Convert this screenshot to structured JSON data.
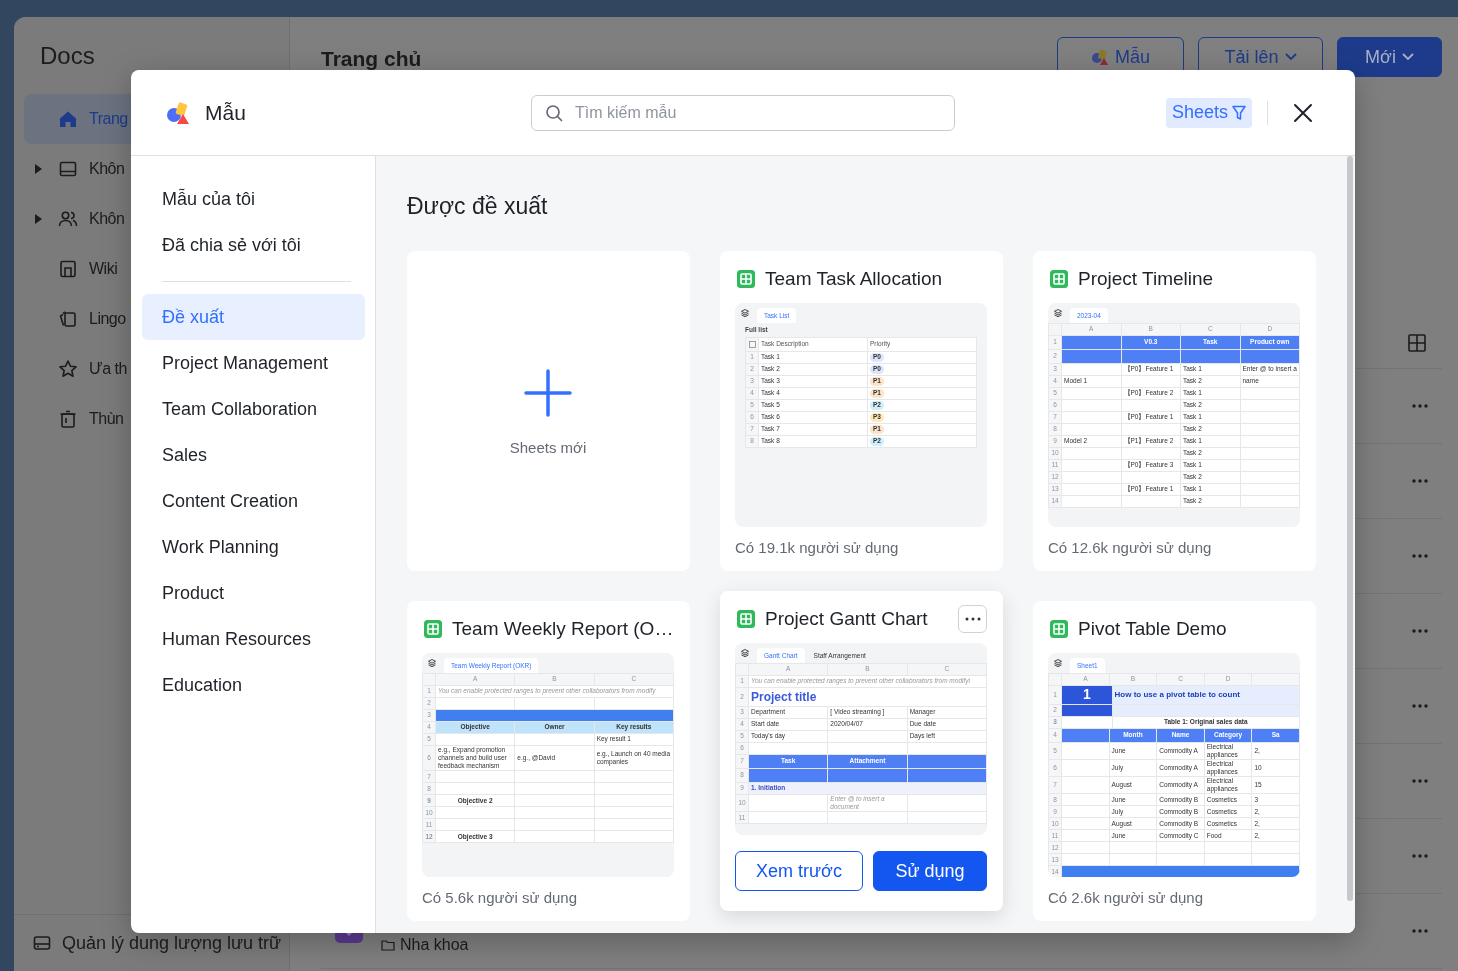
{
  "app": {
    "title": "Docs",
    "nav": [
      {
        "label": "Trang",
        "kind": "home",
        "expandable": false,
        "selected": true
      },
      {
        "label": "Khôn",
        "kind": "tray",
        "expandable": true,
        "selected": false
      },
      {
        "label": "Khôn",
        "kind": "people",
        "expandable": true,
        "selected": false
      },
      {
        "label": "Wiki",
        "kind": "wiki",
        "expandable": false,
        "selected": false
      },
      {
        "label": "Lingo",
        "kind": "cards",
        "expandable": false,
        "selected": false
      },
      {
        "label": "Ưa th",
        "kind": "star",
        "expandable": false,
        "selected": false
      },
      {
        "label": "Thùn",
        "kind": "trash",
        "expandable": false,
        "selected": false
      }
    ],
    "storage": "Quản lý dung lượng lưu trữ",
    "page_title": "Trang chủ",
    "actions": [
      {
        "label": "Mẫu",
        "kind": "template"
      },
      {
        "label": "Tải lên",
        "kind": "dropdown"
      },
      {
        "label": "Mới",
        "kind": "primary"
      }
    ],
    "last_row_folder": "Nha khoa"
  },
  "modal": {
    "title": "Mẫu",
    "search": {
      "placeholder": "Tìm kiếm mẫu"
    },
    "filter": "Sheets",
    "personal": [
      {
        "label": "Mẫu của tôi",
        "selected": false
      },
      {
        "label": "Đã chia sẻ với tôi",
        "selected": false
      }
    ],
    "categories": [
      {
        "label": "Đề xuất",
        "selected": true
      },
      {
        "label": "Project Management",
        "selected": false
      },
      {
        "label": "Team Collaboration",
        "selected": false
      },
      {
        "label": "Sales",
        "selected": false
      },
      {
        "label": "Content Creation",
        "selected": false
      },
      {
        "label": "Work Planning",
        "selected": false
      },
      {
        "label": "Product",
        "selected": false
      },
      {
        "label": "Human Resources",
        "selected": false
      },
      {
        "label": "Education",
        "selected": false
      }
    ],
    "section_title": "Được đề xuất",
    "cards": [
      {
        "kind": "new",
        "label": "Sheets mới"
      },
      {
        "kind": "template",
        "title": "Team Task Allocation",
        "hovered": false,
        "usage": "Có 19.1k người sử dụng",
        "preview": {
          "tabs": [
            {
              "label": "Task List",
              "selected": true
            }
          ],
          "caption": "Full list",
          "rows": [
            {
              "kind": "colhead",
              "cells": [
                "Task Description",
                "Priority"
              ]
            },
            {
              "num": "1",
              "cells": [
                "Task 1",
                {
                  "text": "P0",
                  "color": "#dde4fb"
                }
              ]
            },
            {
              "num": "2",
              "cells": [
                "Task 2",
                {
                  "text": "P0",
                  "color": "#dde4fb"
                }
              ]
            },
            {
              "num": "3",
              "cells": [
                "Task 3",
                {
                  "text": "P1",
                  "color": "#fde2c8"
                }
              ]
            },
            {
              "num": "4",
              "cells": [
                "Task 4",
                {
                  "text": "P1",
                  "color": "#fde2c8"
                }
              ]
            },
            {
              "num": "5",
              "cells": [
                "Task 5",
                {
                  "text": "P2",
                  "color": "#cdeefb"
                }
              ]
            },
            {
              "num": "6",
              "cells": [
                "Task 6",
                {
                  "text": "P3",
                  "color": "#fde9b8"
                }
              ]
            },
            {
              "num": "7",
              "cells": [
                "Task 7",
                {
                  "text": "P1",
                  "color": "#fde2c8"
                }
              ]
            },
            {
              "num": "8",
              "cells": [
                "Task 8",
                {
                  "text": "P2",
                  "color": "#cdeefb"
                }
              ]
            }
          ]
        }
      },
      {
        "kind": "template",
        "title": "Project Timeline",
        "hovered": false,
        "usage": "Có 12.6k người sử dụng",
        "preview": {
          "tabs": [
            {
              "label": "2023-04",
              "selected": true
            }
          ],
          "columns": [
            "A",
            "B",
            "C",
            "D"
          ],
          "rows": [
            {
              "num": "1",
              "kind": "head",
              "cells": [
                null,
                "V0.3",
                "Task",
                "Product own"
              ]
            },
            {
              "num": "2",
              "kind": "head",
              "cells": [
                null,
                null,
                null,
                null
              ]
            },
            {
              "num": "3",
              "cells": [
                null,
                "【P0】Feature 1",
                "Task 1",
                "Enter @ to insert a"
              ]
            },
            {
              "num": "4",
              "cells": [
                "Model 1",
                null,
                "Task 2",
                "name"
              ]
            },
            {
              "num": "5",
              "cells": [
                null,
                "【P0】Feature 2",
                "Task 1",
                null
              ]
            },
            {
              "num": "6",
              "cells": [
                null,
                null,
                "Task 2",
                null
              ]
            },
            {
              "num": "7",
              "cells": [
                null,
                "【P0】Feature 1",
                "Task 1",
                null
              ]
            },
            {
              "num": "8",
              "cells": [
                null,
                null,
                "Task 2",
                null
              ]
            },
            {
              "num": "9",
              "cells": [
                "Model 2",
                "【P1】Feature 2",
                "Task 1",
                null
              ]
            },
            {
              "num": "10",
              "cells": [
                null,
                null,
                "Task 2",
                null
              ]
            },
            {
              "num": "11",
              "cells": [
                null,
                "【P0】Feature 3",
                "Task 1",
                null
              ]
            },
            {
              "num": "12",
              "cells": [
                null,
                null,
                "Task 2",
                null
              ]
            },
            {
              "num": "13",
              "cells": [
                null,
                "【P0】Feature 1",
                "Task 1",
                null
              ]
            },
            {
              "num": "14",
              "cells": [
                null,
                null,
                "Task 2",
                null
              ]
            }
          ]
        }
      },
      {
        "kind": "template",
        "title": "Team Weekly Report (O…",
        "hovered": false,
        "usage": "Có 5.6k người sử dụng",
        "preview": {
          "tabs": [
            {
              "label": "Team Weekly Report (OKR)",
              "selected": true
            }
          ],
          "columns": [
            "A",
            "B",
            "C"
          ],
          "rows": [
            {
              "num": "1",
              "kind": "note",
              "cells": [
                "You can enable protected ranges to prevent other collaborators from modify"
              ]
            },
            {
              "num": "2",
              "cells": [
                null,
                null,
                null
              ]
            },
            {
              "num": "3",
              "kind": "band",
              "cells": [
                null
              ]
            },
            {
              "num": "4",
              "kind": "subhead",
              "cells": [
                "Objective",
                "Owner",
                "Key results"
              ]
            },
            {
              "num": "5",
              "cells": [
                null,
                null,
                "Key result 1"
              ]
            },
            {
              "num": "6",
              "cells": [
                "e.g., Expand promotion channels and build user feedback mechanism",
                "e.g., @David",
                "e.g., Launch on 40 media companies"
              ]
            },
            {
              "num": "7",
              "cells": [
                null,
                null,
                null
              ]
            },
            {
              "num": "8",
              "cells": [
                null,
                null,
                null
              ]
            },
            {
              "num": "9",
              "kind": "bold",
              "cells": [
                "Objective 2",
                null,
                null
              ]
            },
            {
              "num": "10",
              "cells": [
                null,
                null,
                null
              ]
            },
            {
              "num": "11",
              "cells": [
                null,
                null,
                null
              ]
            },
            {
              "num": "12",
              "kind": "bold",
              "cells": [
                "Objective 3",
                null,
                null
              ]
            }
          ]
        }
      },
      {
        "kind": "template",
        "title": "Project Gantt Chart",
        "hovered": true,
        "actions": [
          "Xem trước",
          "Sử dụng"
        ],
        "preview": {
          "tabs": [
            {
              "label": "Gantt Chart",
              "selected": true
            },
            {
              "label": "Staff Arrangement",
              "selected": false
            }
          ],
          "columns": [
            "A",
            "B",
            "C"
          ],
          "rows": [
            {
              "num": "1",
              "kind": "note",
              "cells": [
                "You can enable protected ranges to prevent other collaborators from modifyi"
              ]
            },
            {
              "num": "2",
              "kind": "title",
              "cells": [
                "Project title"
              ]
            },
            {
              "num": "3",
              "cells": [
                "Department",
                "[ Video streaming ]",
                "Manager"
              ]
            },
            {
              "num": "4",
              "cells": [
                "Start date",
                "2020/04/07",
                "Due date"
              ]
            },
            {
              "num": "5",
              "cells": [
                "Today's day",
                null,
                "Days left"
              ]
            },
            {
              "num": "6",
              "cells": [
                null,
                null,
                null
              ]
            },
            {
              "num": "7",
              "kind": "head",
              "cells": [
                "Task",
                "Attachment",
                null
              ]
            },
            {
              "num": "8",
              "kind": "head",
              "cells": [
                null,
                null,
                null
              ]
            },
            {
              "num": "9",
              "kind": "section",
              "cells": [
                "1. Initiation"
              ]
            },
            {
              "num": "10",
              "kind": "note",
              "cells": [
                null,
                "Enter @ to insert a document",
                null
              ]
            },
            {
              "num": "11",
              "cells": [
                null,
                null,
                null
              ]
            }
          ]
        }
      },
      {
        "kind": "template",
        "title": "Pivot Table Demo",
        "hovered": false,
        "usage": "Có 2.6k người sử dụng",
        "preview": {
          "tabs": [
            {
              "label": "Sheet1",
              "selected": true
            }
          ],
          "columns": [
            "A",
            "B",
            "C",
            "D"
          ],
          "rows": [
            {
              "num": "1",
              "kind": "bignum",
              "cells": [
                "1",
                "How to use a pivot table to count"
              ]
            },
            {
              "num": "2",
              "kind": "bignum",
              "cells": [
                null,
                null
              ]
            },
            {
              "num": "3",
              "kind": "bold",
              "cells": [
                null,
                "Table 1: Original sales data"
              ]
            },
            {
              "num": "4",
              "kind": "head",
              "cells": [
                null,
                "Month",
                "Name",
                "Category",
                "Sa"
              ]
            },
            {
              "num": "5",
              "cells": [
                null,
                "June",
                "Commodity A",
                "Electrical appliances",
                "2,"
              ]
            },
            {
              "num": "6",
              "cells": [
                null,
                "July",
                "Commodity A",
                "Electrical appliances",
                "10"
              ]
            },
            {
              "num": "7",
              "cells": [
                null,
                "August",
                "Commodity A",
                "Electrical appliances",
                "15"
              ]
            },
            {
              "num": "8",
              "cells": [
                null,
                "June",
                "Commodity B",
                "Cosmetics",
                "3"
              ]
            },
            {
              "num": "9",
              "cells": [
                null,
                "July",
                "Commodity B",
                "Cosmetics",
                "2,"
              ]
            },
            {
              "num": "10",
              "cells": [
                null,
                "August",
                "Commodity B",
                "Cosmetics",
                "2,"
              ]
            },
            {
              "num": "11",
              "cells": [
                null,
                "June",
                "Commodity C",
                "Food",
                "2,"
              ]
            },
            {
              "num": "12",
              "cells": [
                null,
                null,
                null,
                null,
                null
              ]
            },
            {
              "num": "13",
              "cells": [
                null,
                null,
                null,
                null,
                null
              ]
            },
            {
              "num": "14",
              "kind": "band",
              "cells": [
                null
              ]
            }
          ]
        }
      }
    ]
  }
}
